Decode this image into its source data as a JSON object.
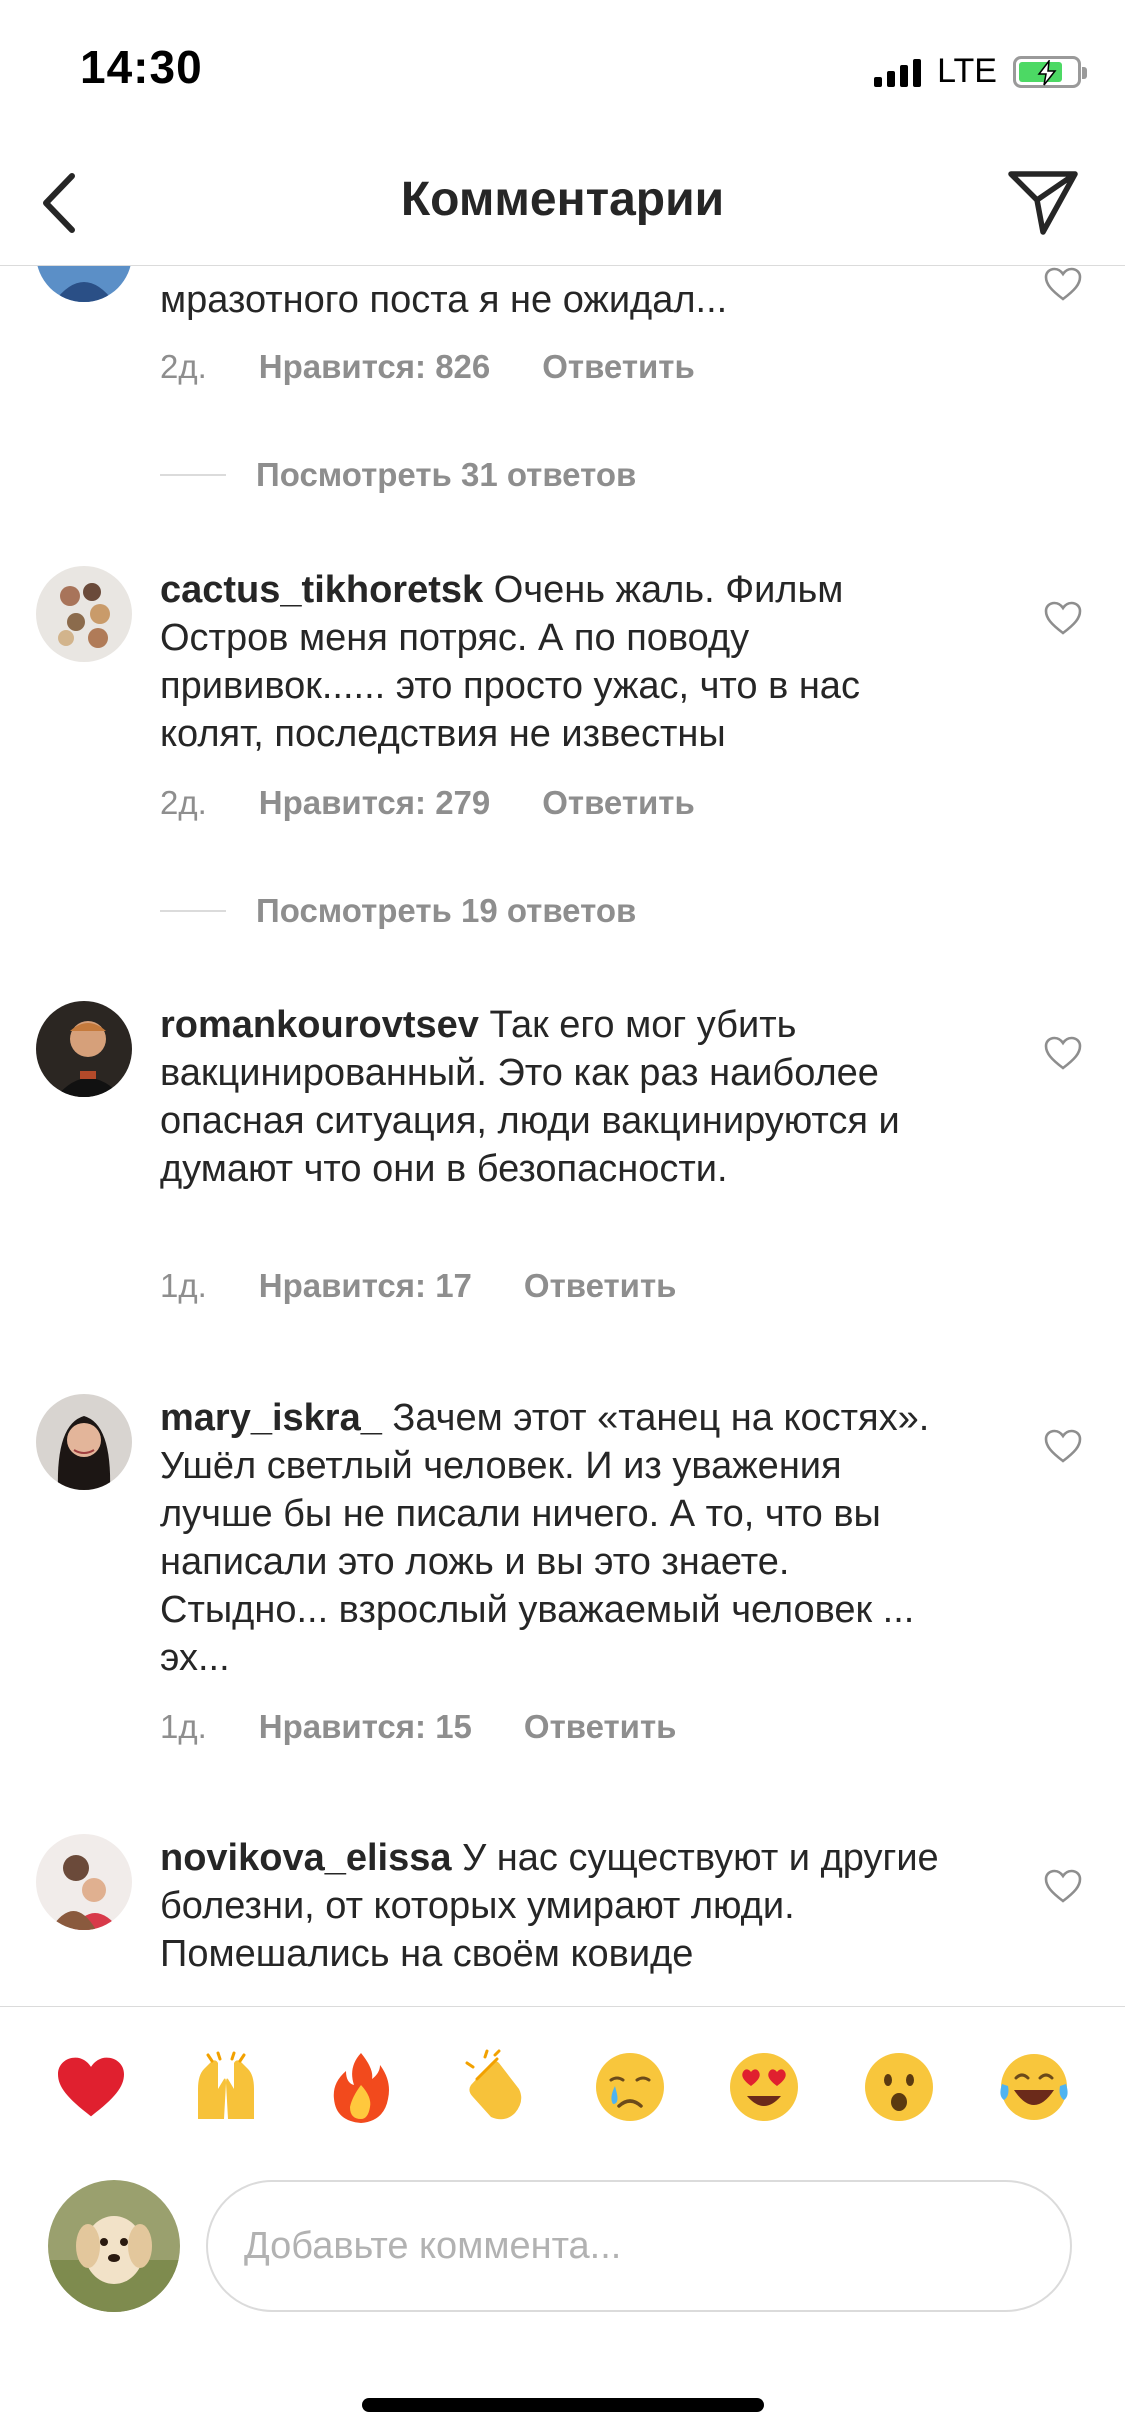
{
  "status_bar": {
    "time": "14:30",
    "network": "LTE",
    "battery_charging": true
  },
  "header": {
    "title": "Комментарии",
    "back_icon": "chevron-left-icon",
    "share_icon": "paper-plane-icon"
  },
  "comments": [
    {
      "username": "",
      "text": "мразотного поста я не ожидал...",
      "time": "2д.",
      "likes": "Нравится: 826",
      "reply": "Ответить",
      "view_replies": "Посмотреть 31 ответов"
    },
    {
      "username": "cactus_tikhoretsk",
      "text": "Очень жаль.  Фильм Остров  меня потряс. А по поводу прививок...... это просто ужас,  что в нас колят,  последствия не известны",
      "time": "2д.",
      "likes": "Нравится: 279",
      "reply": "Ответить",
      "view_replies": "Посмотреть 19 ответов"
    },
    {
      "username": "romankourovtsev",
      "text": "Так его мог убить вакцинированный. Это как раз наиболее опасная ситуация, люди вакцинируются и думают что они в безопасности.",
      "time": "1д.",
      "likes": "Нравится: 17",
      "reply": "Ответить"
    },
    {
      "username": "mary_iskra_",
      "text": "Зачем этот «танец на костях». Ушёл светлый человек. И из уважения лучше бы не писали ничего. А то, что вы написали это ложь и вы это знаете. Стыдно... взрослый уважаемый человек ... эх...",
      "time": "1д.",
      "likes": "Нравится: 15",
      "reply": "Ответить"
    },
    {
      "username": "novikova_elissa",
      "text": "У нас существуют и другие болезни, от которых умирают люди. Помешались на своём ковиде"
    }
  ],
  "emoji_bar": [
    "❤️",
    "🙌",
    "🔥",
    "👏",
    "😢",
    "😍",
    "😮",
    "😂"
  ],
  "composer": {
    "placeholder": "Добавьте коммента..."
  },
  "colors": {
    "text": "#262626",
    "secondary": "#8e8e8e",
    "border": "#dbdbdb"
  }
}
